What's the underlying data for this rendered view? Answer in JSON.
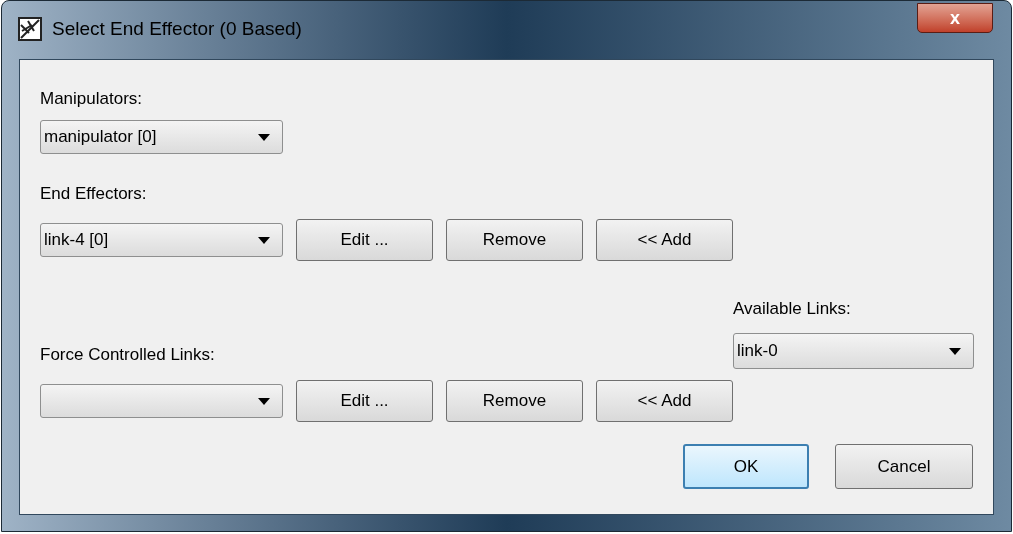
{
  "window": {
    "title": "Select End Effector (0 Based)",
    "close": "x"
  },
  "manipulators": {
    "label": "Manipulators:",
    "value": "manipulator [0]"
  },
  "end_effectors": {
    "label": "End Effectors:",
    "value": "link-4 [0]",
    "buttons": [
      "Edit ...",
      "Remove",
      "<< Add"
    ]
  },
  "available_links": {
    "label": "Available Links:",
    "value": "link-0"
  },
  "force_controlled_links": {
    "label": "Force Controlled Links:",
    "buttons": [
      "Edit ...",
      "Remove",
      "<< Add"
    ]
  },
  "dialog_buttons": [
    {
      "label": "OK",
      "default": true
    },
    {
      "label": "Cancel",
      "default": false
    }
  ]
}
